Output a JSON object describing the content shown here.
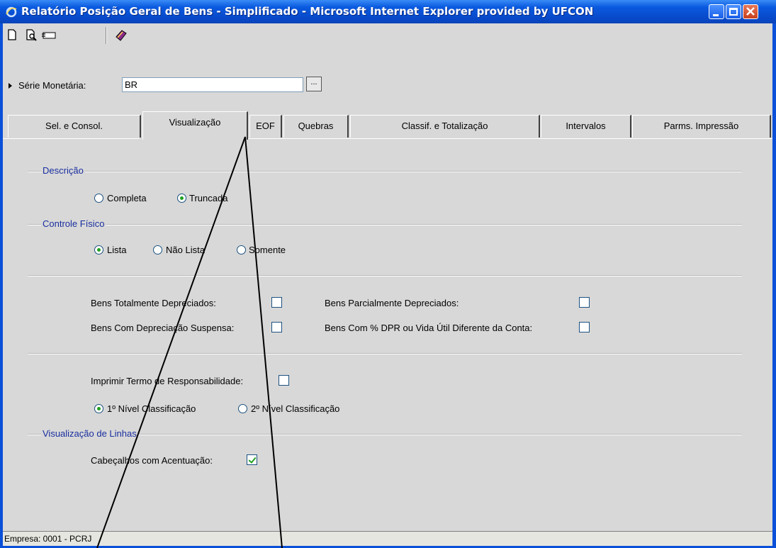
{
  "window": {
    "title": "Relatório Posição Geral de Bens - Simplificado - Microsoft Internet Explorer provided by UFCON"
  },
  "toolbar": {
    "icons": [
      "new-document-icon",
      "print-preview-icon",
      "export-icon",
      "book-icon"
    ]
  },
  "serie": {
    "label": "Série Monetária:",
    "value": "BR",
    "button": "..."
  },
  "tabs": [
    {
      "label": "Sel. e Consol."
    },
    {
      "label": "Visualização"
    },
    {
      "label": "EOF"
    },
    {
      "label": "Quebras"
    },
    {
      "label": "Classif. e Totalização"
    },
    {
      "label": "Intervalos"
    },
    {
      "label": "Parms. Impressão"
    }
  ],
  "descricao": {
    "title": "Descrição",
    "options": [
      "Completa",
      "Truncada"
    ],
    "selected": "Truncada"
  },
  "controle": {
    "title": "Controle Físico",
    "options": [
      "Lista",
      "Não Lista",
      "Somente"
    ],
    "selected": "Lista"
  },
  "bens": {
    "totalmente": "Bens Totalmente Depreciados:",
    "parcialmente": "Bens Parcialmente Depreciados:",
    "suspensa": "Bens Com Depreciação Suspensa:",
    "dpr": "Bens Com % DPR ou Vida Útil Diferente da Conta:"
  },
  "termo": {
    "label": "Imprimir Termo de Responsabilidade:"
  },
  "nivel": {
    "options": [
      "1º Nível Classificação",
      "2º Nível Classificação"
    ],
    "selected": "1º Nível Classificação"
  },
  "linhas": {
    "title": "Visualização de Linhas",
    "cabecalhos": "Cabeçalhos com Acentuação:"
  },
  "status": {
    "text": "Empresa: 0001 - PCRJ"
  },
  "colors": {
    "titlebar": "#0a50d8",
    "group_label": "#1a2fa0",
    "radio_dot": "#21a121"
  }
}
